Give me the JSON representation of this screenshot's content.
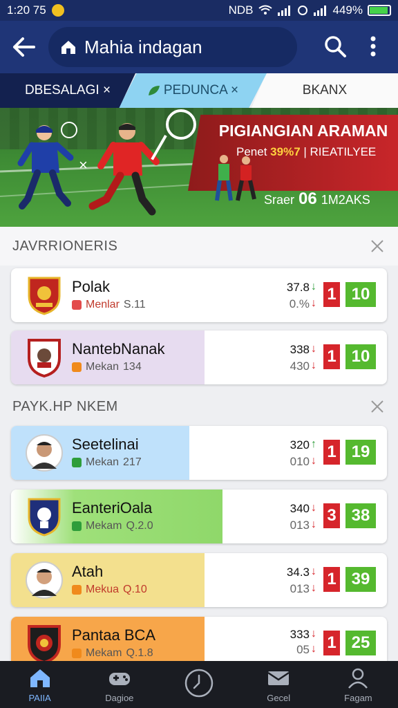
{
  "status_bar": {
    "time": "1:20 75",
    "indicators": "NDB",
    "battery": "449%",
    "colors": {
      "background": "#1a2c63",
      "battery_fill": "#46d24a"
    }
  },
  "app_bar": {
    "title": "Mahia indagan",
    "icons": [
      "back-arrow-icon",
      "home-icon",
      "search-icon",
      "more-vertical-icon"
    ]
  },
  "tabs": [
    {
      "label": "DBESALAGI ×"
    },
    {
      "label": "PEDUNCA ×"
    },
    {
      "label": "BKANX"
    }
  ],
  "banner": {
    "title": "PIGIANGIAN ARAMAN",
    "sub_prefix": "Penet",
    "sub_pct": "39%7",
    "sub_suffix": "| RIEATILYEE",
    "bottom_prefix": "Sraer",
    "bottom_num": "06",
    "bottom_suffix": "1M2AKS"
  },
  "sections": [
    {
      "title": "JAVRRIONERIS",
      "items": [
        {
          "name": "Polak",
          "league": "Menlar",
          "sub_value": "S.11",
          "stat1": "37.8",
          "stat2": "0.%",
          "arrow1": "↓",
          "arrow2": "↓",
          "red": "1",
          "green": "10",
          "tint": ""
        },
        {
          "name": "NantebNanak",
          "league": "Mekan",
          "sub_value": "134",
          "stat1": "338",
          "stat2": "430",
          "arrow1": "↓",
          "arrow2": "↓",
          "red": "1",
          "green": "10",
          "tint": "#e7dcf0"
        }
      ]
    },
    {
      "title": "PAYK.HP NKEM",
      "items": [
        {
          "name": "Seetelinai",
          "league": "Mekan",
          "sub_value": "217",
          "stat1": "320",
          "stat2": "010",
          "arrow1": "↑",
          "arrow2": "↓",
          "red": "1",
          "green": "19",
          "tint": "#bfe1fb"
        },
        {
          "name": "EanteriOala",
          "league": "Mekam",
          "sub_value": "Q.2.0",
          "stat1": "340",
          "stat2": "013",
          "arrow1": "↓",
          "arrow2": "↓",
          "red": "3",
          "green": "38",
          "tint": "#9fe07a"
        },
        {
          "name": "Atah",
          "league": "Mekua",
          "sub_value": "Q.10",
          "stat1": "34.3",
          "stat2": "013",
          "arrow1": "↓",
          "arrow2": "↓",
          "red": "1",
          "green": "39",
          "tint": "#f3e08e"
        },
        {
          "name": "Pantaa BCA",
          "league": "Mekam",
          "sub_value": "Q.1.8",
          "stat1": "333",
          "stat2": "05",
          "arrow1": "↓",
          "arrow2": "↓",
          "red": "1",
          "green": "25",
          "tint": "#f7a64a"
        }
      ]
    }
  ],
  "bottom_nav": [
    {
      "label": "PAIIA",
      "icon": "home-icon",
      "active": true
    },
    {
      "label": "Dagioe",
      "icon": "gamepad-icon",
      "active": false
    },
    {
      "label": "",
      "icon": "clock-icon",
      "active": false
    },
    {
      "label": "Gecel",
      "icon": "mail-icon",
      "active": false
    },
    {
      "label": "Fagam",
      "icon": "profile-icon",
      "active": false
    }
  ],
  "colors": {
    "primary": "#1f3577",
    "tab_active": "#13214f",
    "tab_mid": "#8ed3f2",
    "red_badge": "#d6252b",
    "green_badge": "#55b92f",
    "nav_bg": "#1a1c22"
  }
}
